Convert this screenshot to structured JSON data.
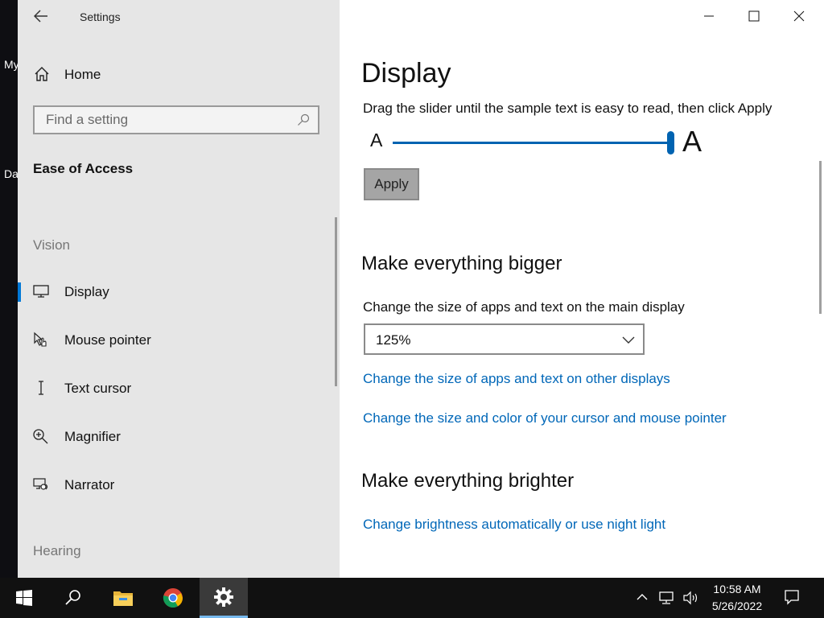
{
  "desktop": {
    "icon_labels": [
      "My",
      "Da"
    ]
  },
  "window": {
    "title": "Settings",
    "back": "←"
  },
  "sidebar": {
    "home_label": "Home",
    "search_placeholder": "Find a setting",
    "category": "Ease of Access",
    "section_vision": "Vision",
    "section_hearing": "Hearing",
    "items": [
      {
        "label": "Display",
        "icon": "monitor-icon",
        "selected": true
      },
      {
        "label": "Mouse pointer",
        "icon": "mouse-pointer-icon"
      },
      {
        "label": "Text cursor",
        "icon": "text-cursor-icon"
      },
      {
        "label": "Magnifier",
        "icon": "magnifier-icon"
      },
      {
        "label": "Narrator",
        "icon": "narrator-icon"
      }
    ]
  },
  "content": {
    "title": "Display",
    "slider_description": "Drag the slider until the sample text is easy to read, then click Apply",
    "sample_small": "A",
    "sample_large": "A",
    "text_size_slider_level": 1.0,
    "apply_label": "Apply",
    "section_bigger": "Make everything bigger",
    "scale_label": "Change the size of apps and text on the main display",
    "scale_value": "125%",
    "link_other_displays": "Change the size of apps and text on other displays",
    "link_cursor": "Change the size and color of your cursor and mouse pointer",
    "section_brighter": "Make everything brighter",
    "link_brightness": "Change brightness automatically or use night light"
  },
  "taskbar": {
    "time": "10:58 AM",
    "date": "5/26/2022",
    "pinned": [
      "start-icon",
      "search-icon",
      "file-explorer-icon",
      "chrome-icon",
      "settings-icon"
    ],
    "active": "settings-icon"
  },
  "colors": {
    "accent": "#0078d7",
    "link": "#0067b8",
    "sidebar_bg": "#e6e6e6",
    "taskbar_bg": "#111111"
  }
}
